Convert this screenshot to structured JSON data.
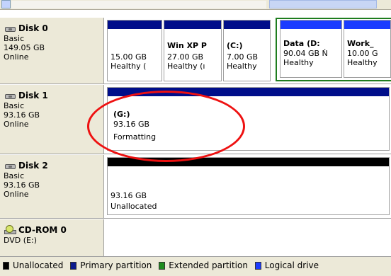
{
  "disks": [
    {
      "name": "Disk 0",
      "type": "Basic",
      "size": "149.05 GB",
      "status": "Online",
      "partitions": [
        {
          "name": "",
          "size": "15.00 GB",
          "status": "Healthy (",
          "kind": "primary"
        },
        {
          "name": "Win XP P",
          "size": "27.00 GB",
          "status": "Healthy (ı",
          "kind": "primary"
        },
        {
          "name": "(C:)",
          "size": "7.00 GB",
          "status": "Healthy",
          "kind": "primary"
        },
        {
          "name": "Data  (D:",
          "size": "90.04 GB Ń",
          "status": "Healthy",
          "kind": "logical"
        },
        {
          "name": "Work_",
          "size": "10.00 G",
          "status": "Healthy",
          "kind": "logical"
        }
      ]
    },
    {
      "name": "Disk 1",
      "type": "Basic",
      "size": "93.16 GB",
      "status": "Online",
      "partitions": [
        {
          "name": "(G:)",
          "size": "93.16 GB",
          "status": "Formatting",
          "kind": "primary"
        }
      ]
    },
    {
      "name": "Disk 2",
      "type": "Basic",
      "size": "93.16 GB",
      "status": "Online",
      "partitions": [
        {
          "name": "",
          "size": "93.16 GB",
          "status": "Unallocated",
          "kind": "unallocated"
        }
      ]
    },
    {
      "name": "CD-ROM 0",
      "type": "DVD (E:)"
    }
  ],
  "legend": [
    {
      "label": "Unallocated",
      "color": "#000000"
    },
    {
      "label": "Primary partition",
      "color": "#0b1a8c"
    },
    {
      "label": "Extended partition",
      "color": "#1e8c1e"
    },
    {
      "label": "Logical drive",
      "color": "#1c3bff"
    }
  ],
  "colors": {
    "primary": "#000e8a",
    "logical": "#1a3cff",
    "extended": "#1e7d1e",
    "unallocated": "#000000",
    "annotation": "#ee1111"
  }
}
